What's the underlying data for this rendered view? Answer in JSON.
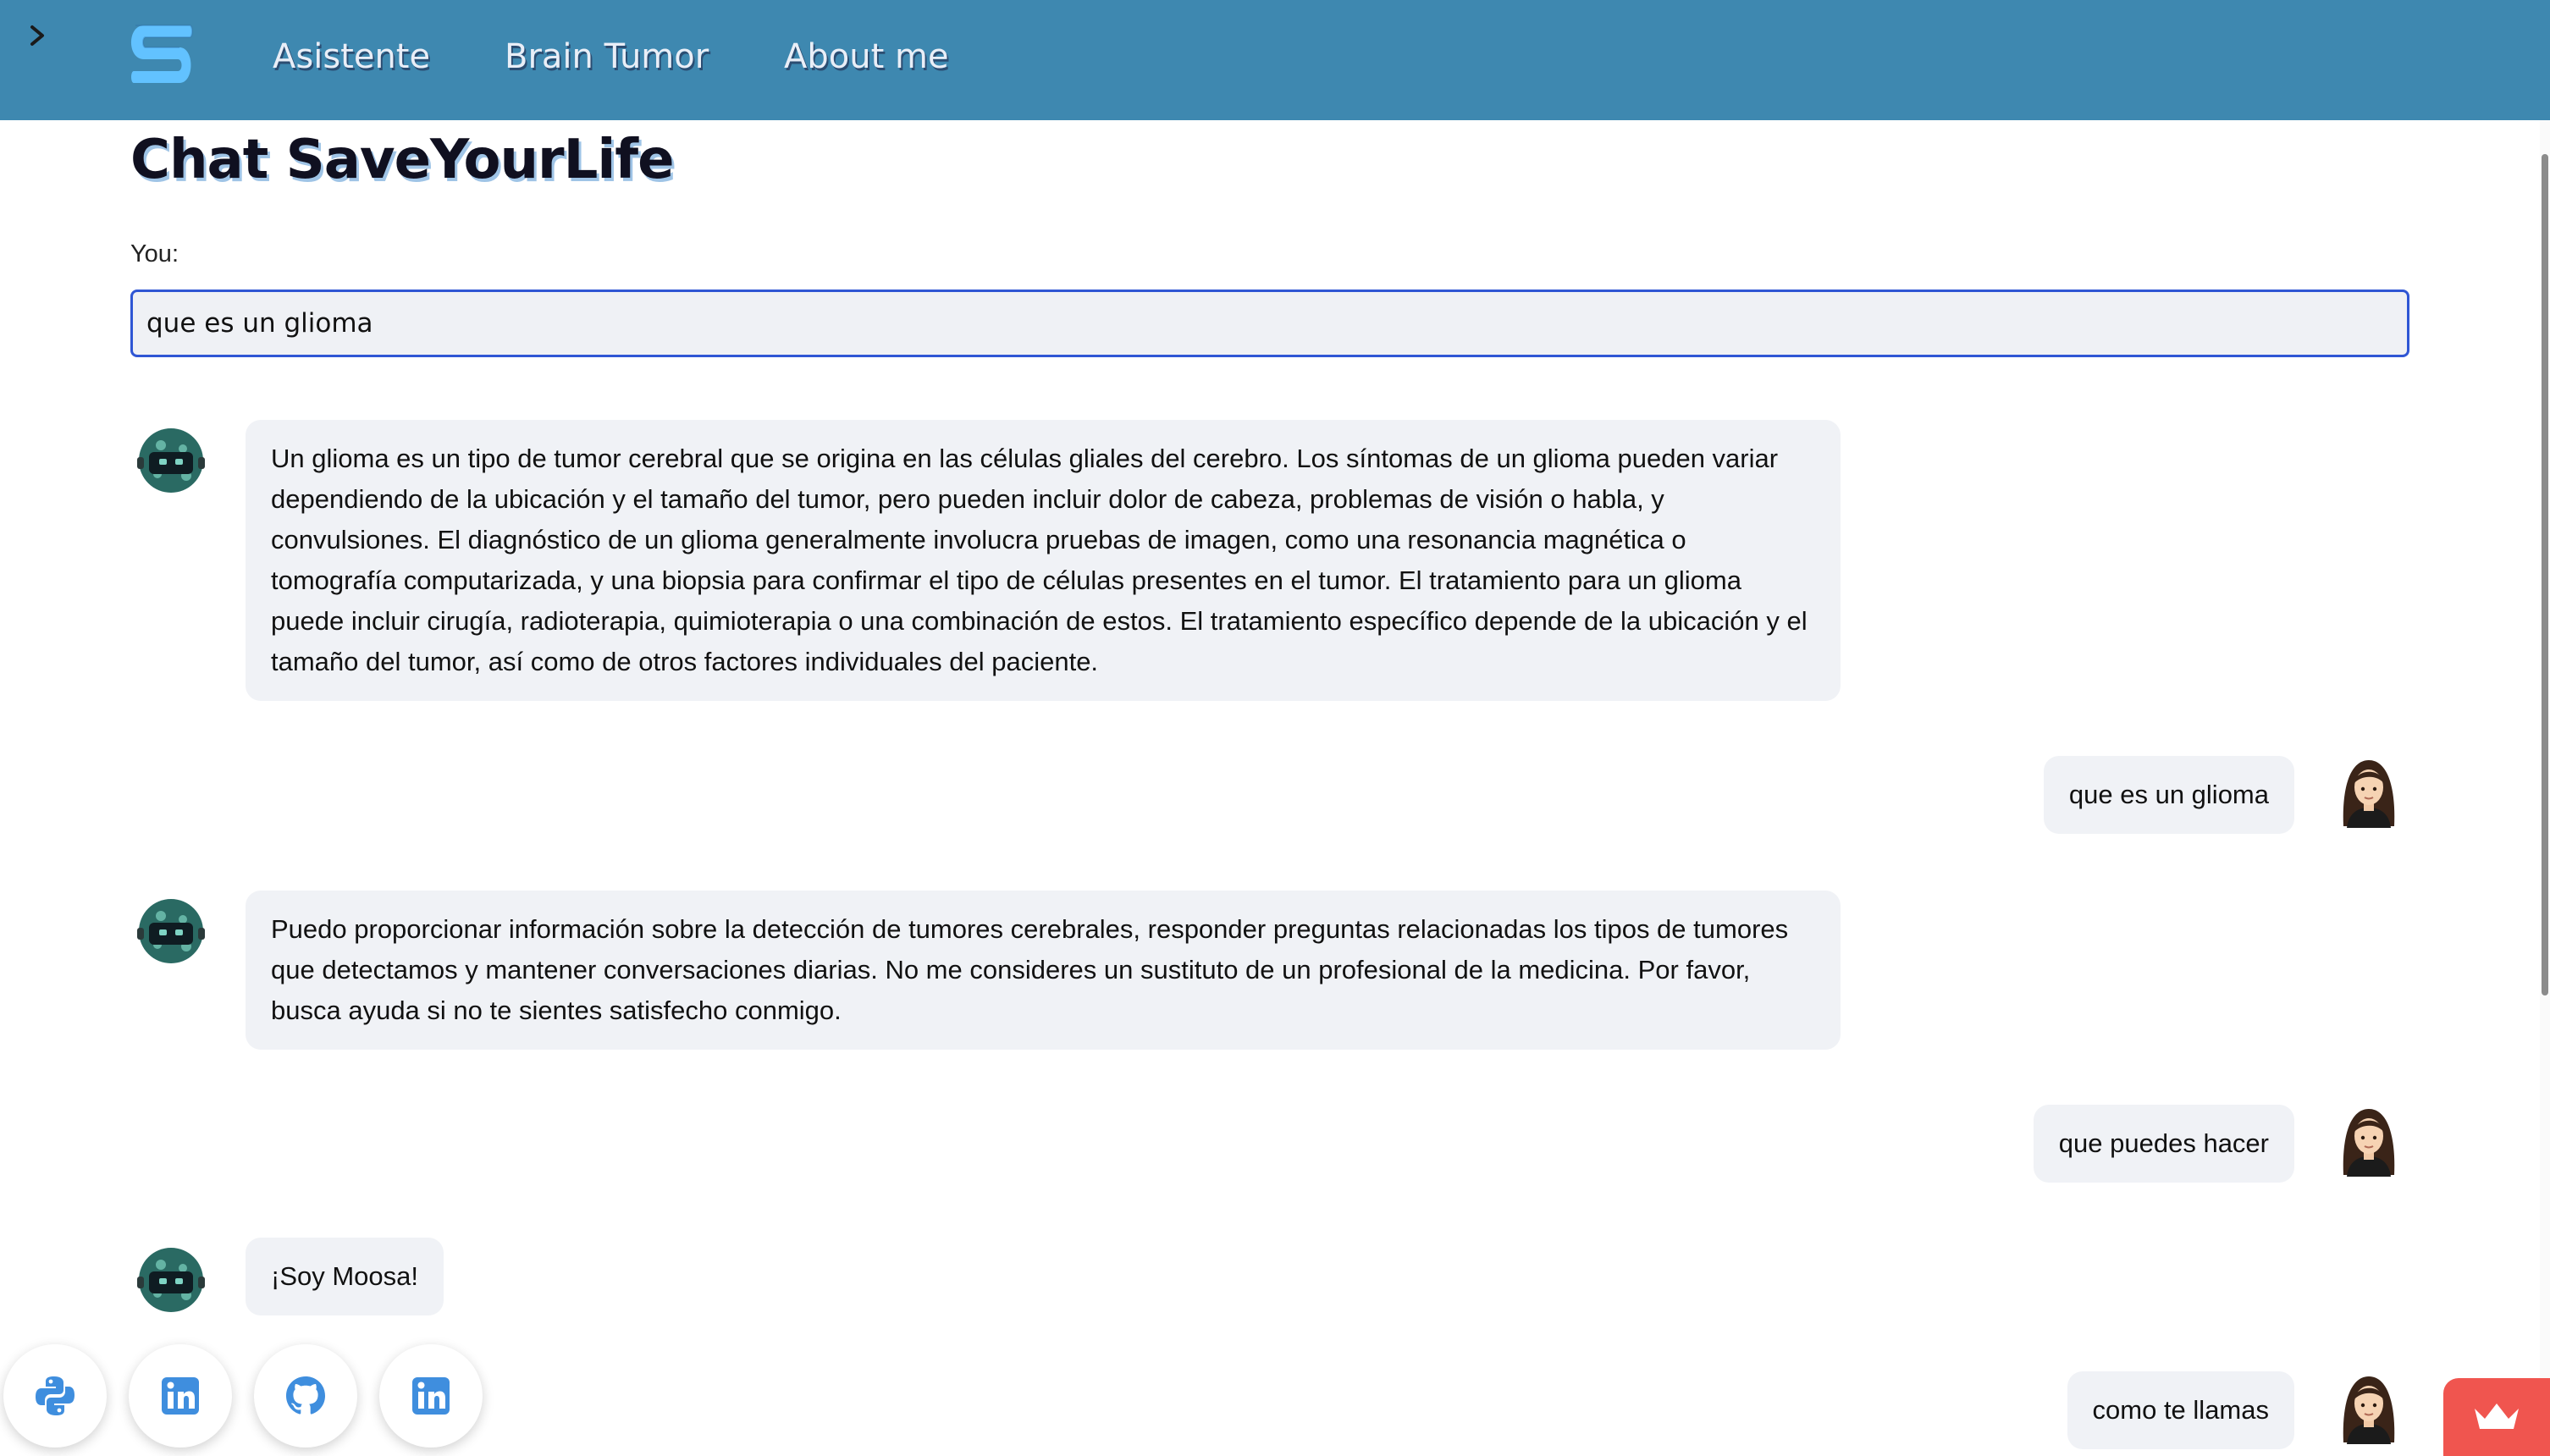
{
  "nav": {
    "items": [
      {
        "label": "Asistente"
      },
      {
        "label": "Brain Tumor"
      },
      {
        "label": "About me"
      }
    ]
  },
  "header": {
    "title": "Chat SaveYourLife"
  },
  "input": {
    "label": "You:",
    "value": "que es un glioma"
  },
  "messages": [
    {
      "role": "bot",
      "text": "Un glioma es un tipo de tumor cerebral que se origina en las células gliales del cerebro. Los síntomas de un glioma pueden variar dependiendo de la ubicación y el tamaño del tumor, pero pueden incluir dolor de cabeza, problemas de visión o habla, y convulsiones. El diagnóstico de un glioma generalmente involucra pruebas de imagen, como una resonancia magnética o tomografía computarizada, y una biopsia para confirmar el tipo de células presentes en el tumor. El tratamiento para un glioma puede incluir cirugía, radioterapia, quimioterapia o una combinación de estos. El tratamiento específico depende de la ubicación y el tamaño del tumor, así como de otros factores individuales del paciente."
    },
    {
      "role": "user",
      "text": "que es un glioma"
    },
    {
      "role": "bot",
      "text": "Puedo proporcionar información sobre la detección de tumores cerebrales, responder preguntas relacionadas los tipos de tumores que detectamos y mantener conversaciones diarias. No me consideres un sustituto de un profesional de la medicina. Por favor, busca ayuda si no te sientes satisfecho conmigo."
    },
    {
      "role": "user",
      "text": "que puedes hacer"
    },
    {
      "role": "bot",
      "text": "¡Soy Moosa!"
    },
    {
      "role": "user",
      "text": "como te llamas"
    }
  ],
  "social": [
    {
      "icon": "python-icon"
    },
    {
      "icon": "linkedin-icon"
    },
    {
      "icon": "github-icon"
    },
    {
      "icon": "linkedin-icon"
    }
  ],
  "icons": {
    "sidebar_toggle": "chevron-right-icon",
    "logo": "saveyourlife-logo",
    "bot_avatar": "robot-avatar-icon",
    "user_avatar": "user-avatar-icon",
    "corner": "crown-icon"
  },
  "colors": {
    "topbar": "#3e88b0",
    "nav_text": "#e9eef7",
    "input_border": "#2f56d4",
    "bubble": "#f0f2f6",
    "corner_badge": "#f0554f",
    "social_icon": "#3f8ede"
  }
}
